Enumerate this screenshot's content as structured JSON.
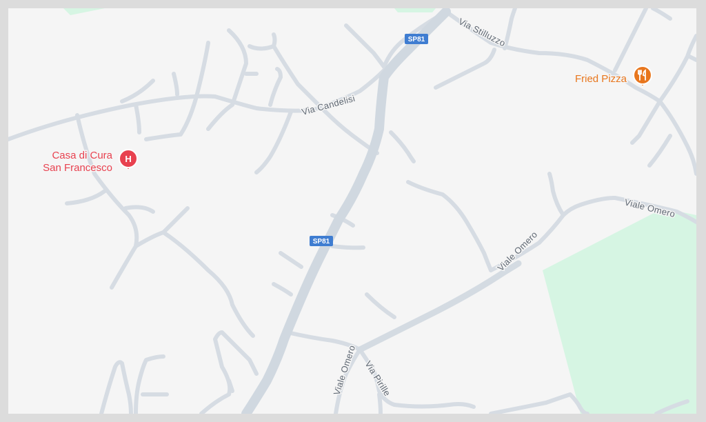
{
  "map": {
    "colors": {
      "background": "#f5f5f5",
      "road": "#d6dce3",
      "park": "#d6f5e3",
      "hospital": "#e8414f",
      "restaurant": "#e8761d",
      "route_shield": "#3f7dd1"
    },
    "route_shields": [
      {
        "label": "SP81"
      },
      {
        "label": "SP81"
      }
    ],
    "streets": [
      {
        "label": "Via Candelisi"
      },
      {
        "label": "Via Stilluzzo"
      },
      {
        "label": "Viale Omero"
      },
      {
        "label": "Viale Omero"
      },
      {
        "label": "Viale Omero"
      },
      {
        "label": "Via Pirille"
      }
    ],
    "pois": [
      {
        "name_line1": "Casa di Cura",
        "name_line2": "San Francesco",
        "icon": "hospital-icon",
        "icon_glyph": "H"
      },
      {
        "name_line1": "Fried Pizza",
        "icon": "restaurant-icon",
        "icon_glyph": "🍴"
      }
    ]
  }
}
